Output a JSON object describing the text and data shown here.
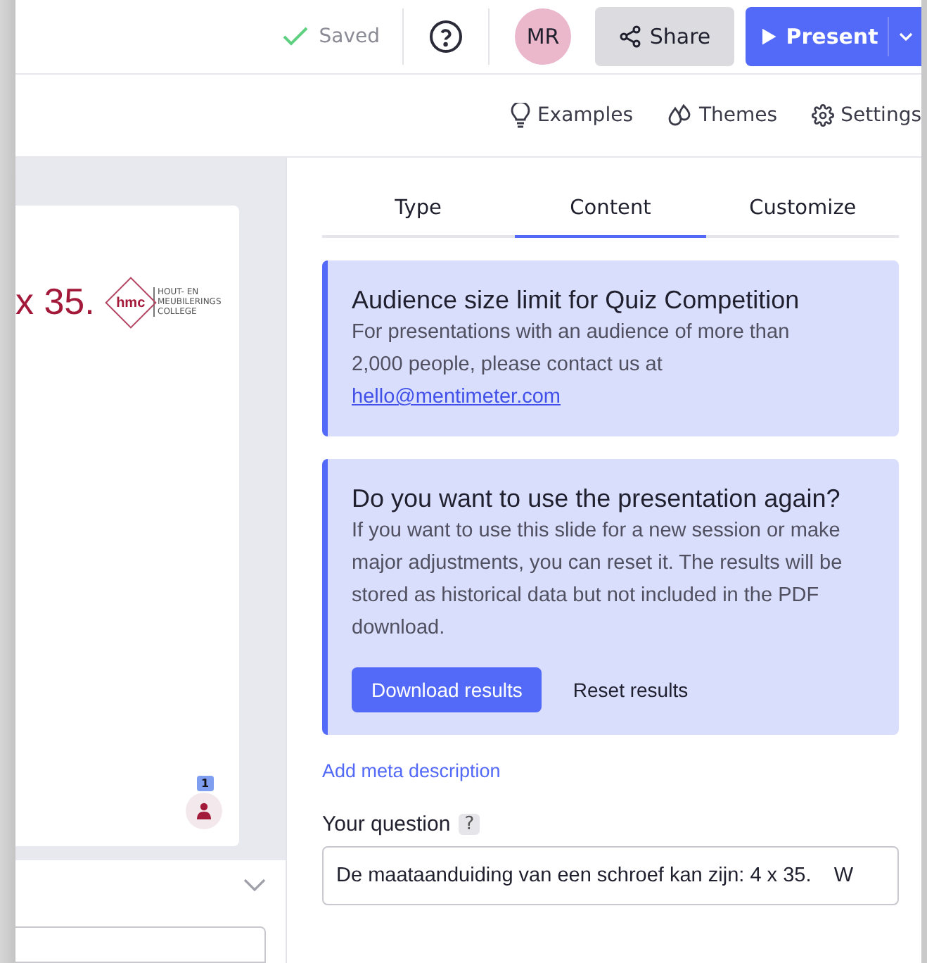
{
  "topbar": {
    "saved": "Saved",
    "avatar": "MR",
    "share": "Share",
    "present": "Present"
  },
  "toolbar": [
    "Examples",
    "Themes",
    "Settings"
  ],
  "slide": {
    "title_fragment": "x 35.",
    "logo_mark": "hmc",
    "logo_caption": "HOUT- EN MEUBILERINGS COLLEGE",
    "participants": "1"
  },
  "tabs": [
    {
      "label": "Type",
      "selected": false
    },
    {
      "label": "Content",
      "selected": true
    },
    {
      "label": "Customize",
      "selected": false
    }
  ],
  "notices": [
    {
      "title": "Audience size limit for Quiz Competition",
      "body": "For presentations with an audience of more than 2,000 people, please contact us at",
      "link": "hello@mentimeter.com"
    },
    {
      "title": "Do you want to use the presentation again?",
      "body": "If you want to use this slide for a new session or make major adjustments, you can reset it. The results will be stored as historical data but not included in the PDF download.",
      "buttons": [
        {
          "label": "Download results",
          "kind": "primary"
        },
        {
          "label": "Reset results",
          "kind": "plain"
        }
      ]
    }
  ],
  "meta_link": "Add meta description",
  "question": {
    "label": "Your question",
    "help": "?",
    "value": "De maataanduiding van een schroef kan zijn: 4 x 35.    W"
  }
}
